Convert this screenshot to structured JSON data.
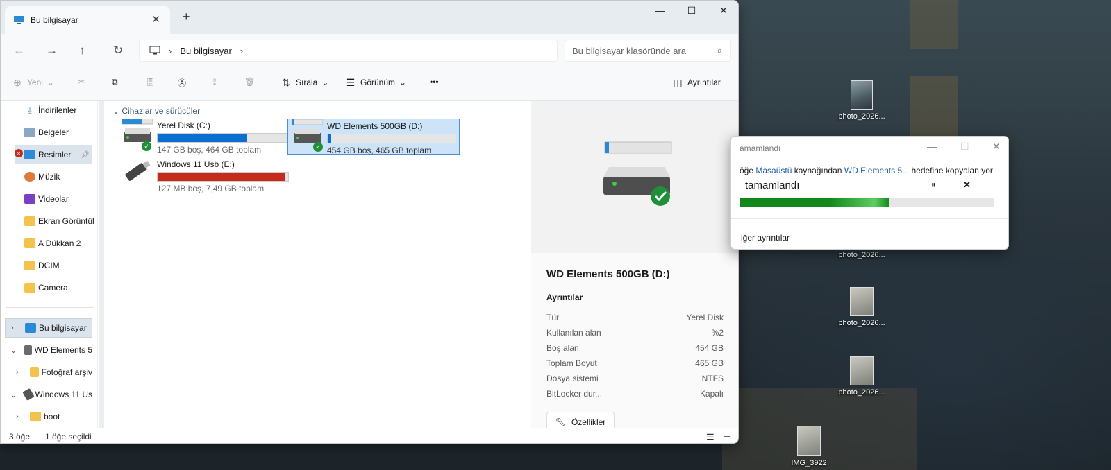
{
  "window": {
    "tab_title": "Bu bilgisayar",
    "search_placeholder": "Bu bilgisayar klasöründe ara"
  },
  "address": {
    "crumb": "Bu bilgisayar"
  },
  "toolbar": {
    "new": "Yeni",
    "sort": "Sırala",
    "view": "Görünüm",
    "details": "Ayrıntılar",
    "more": "•••"
  },
  "sidebar": {
    "items": [
      {
        "label": "İndirilenler"
      },
      {
        "label": "Belgeler"
      },
      {
        "label": "Resimler"
      },
      {
        "label": "Müzik"
      },
      {
        "label": "Videolar"
      },
      {
        "label": "Ekran Görüntül"
      },
      {
        "label": "A Dükkan 2"
      },
      {
        "label": "DCIM"
      },
      {
        "label": "Camera"
      },
      {
        "label": "Bu bilgisayar"
      },
      {
        "label": "WD Elements 5"
      },
      {
        "label": "Fotoğraf arşiv"
      },
      {
        "label": "Windows 11 Us"
      },
      {
        "label": "boot"
      }
    ]
  },
  "main": {
    "group": "Cihazlar ve sürücüler",
    "drives": [
      {
        "name": "Yerel Disk (C:)",
        "sub": "147 GB boş, 464 GB toplam",
        "used_fraction": 0.68,
        "bar_color": "#0a6fd1"
      },
      {
        "name": "WD Elements 500GB (D:)",
        "sub": "454 GB boş, 465 GB toplam",
        "used_fraction": 0.02,
        "bar_color": "#0a6fd1"
      },
      {
        "name": "Windows 11 Usb (E:)",
        "sub": "127 MB boş, 7,49 GB toplam",
        "used_fraction": 0.98,
        "bar_color": "#c42b1c"
      }
    ]
  },
  "details": {
    "title": "WD Elements 500GB (D:)",
    "section": "Ayrıntılar",
    "rows": [
      {
        "k": "Tür",
        "v": "Yerel Disk"
      },
      {
        "k": "Kullanılan alan",
        "v": "%2"
      },
      {
        "k": "Boş alan",
        "v": "454 GB"
      },
      {
        "k": "Toplam Boyut",
        "v": "465 GB"
      },
      {
        "k": "Dosya sistemi",
        "v": "NTFS"
      },
      {
        "k": "BitLocker dur...",
        "v": "Kapalı"
      }
    ],
    "props": "Özellikler"
  },
  "status": {
    "count": "3 öğe",
    "selected": "1 öğe seçildi"
  },
  "dialog": {
    "title": "amamlandı",
    "pre": "öğe ",
    "src": "Masaüstü",
    "mid": " kaynağından ",
    "dst": "WD Elements 5...",
    "post": " hedefine kopyalanıyor",
    "progress_label": "tamamlandı",
    "progress": 0.59,
    "more": "iğer ayrıntılar"
  },
  "desktop": {
    "icons": [
      {
        "label": "photo_2026..."
      },
      {
        "label": "photo_2026..."
      },
      {
        "label": "photo_2026..."
      },
      {
        "label": "photo_2026..."
      },
      {
        "label": "IMG_3922"
      }
    ]
  }
}
